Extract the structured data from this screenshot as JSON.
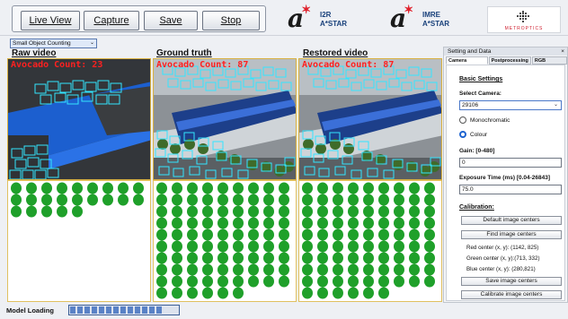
{
  "toolbar": {
    "live_view": "Live View",
    "capture": "Capture",
    "save": "Save",
    "stop": "Stop"
  },
  "logos": {
    "i2r_line1": "I2R",
    "i2r_line2": "A*STAR",
    "imre_line1": "IMRE",
    "imre_line2": "A*STAR",
    "metro": "METROPTICS"
  },
  "mode_select": {
    "value": "Small Object Counting"
  },
  "videos": {
    "raw": {
      "title": "Raw video",
      "count_label": "Avocado Count: 23",
      "count": 23
    },
    "ground": {
      "title": "Ground truth",
      "count_label": "Avocado Count: 87",
      "count": 87
    },
    "restored": {
      "title": "Restored video",
      "count_label": "Avocado Count: 87",
      "count": 87
    }
  },
  "status": {
    "label": "Model Loading",
    "progress_segments": 13
  },
  "settings": {
    "header": "Setting and Data",
    "close": "×",
    "tabs": [
      "Camera Settings",
      "Postprocessing",
      "RGB Settings"
    ],
    "basic_settings": "Basic Settings",
    "select_camera_label": "Select Camera:",
    "camera_value": "29106",
    "monochromatic": "Monochromatic",
    "colour": "Colour",
    "gain_label": "Gain: [0-480]",
    "gain_value": "0",
    "exposure_label": "Exposure Time (ms) [0.04-26843]",
    "exposure_value": "75.0",
    "calibration": "Calibration:",
    "default_centers": "Default image centers",
    "find_centers": "Find image centers",
    "red_center": "Red center (x, y):  (1142, 825)",
    "green_center": "Green center (x, y):(713, 332)",
    "blue_center": "Blue center (x, y):  (280,821)",
    "save_centers": "Save image centers",
    "calibrate_centers": "Calibrate image centers"
  },
  "colors": {
    "accent": "#1e64d0",
    "box": "#33e5ff",
    "count_text": "#ff2020",
    "dot": "#1fa02a"
  }
}
